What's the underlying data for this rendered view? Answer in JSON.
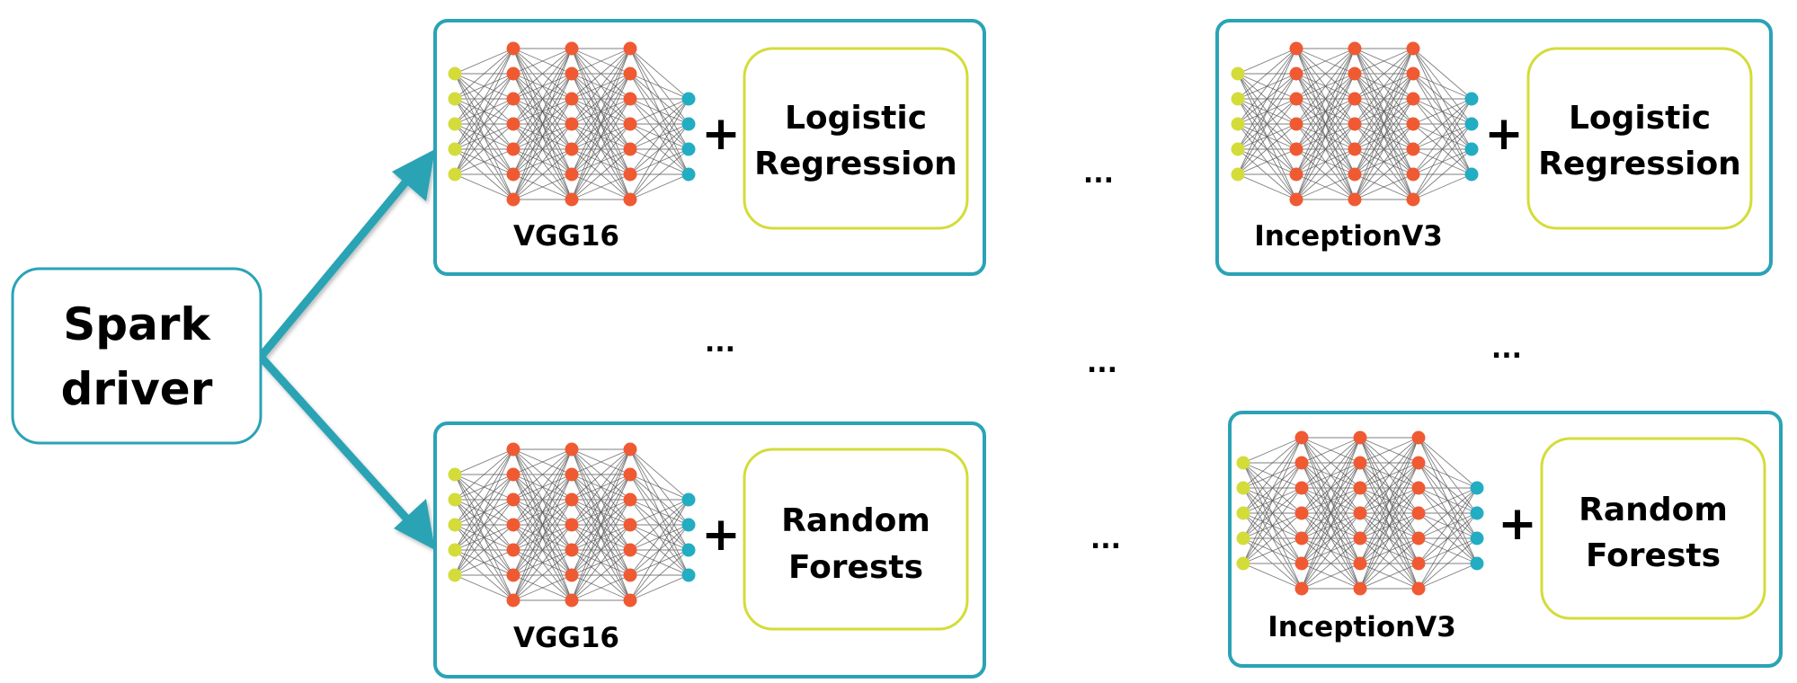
{
  "driver": {
    "line1": "Spark",
    "line2": "driver"
  },
  "colors": {
    "accent": "#2aa3b5",
    "classifier_border": "#d4dc3a",
    "input_node": "#d4dc3a",
    "hidden_node": "#f05a33",
    "output_node": "#22adc3"
  },
  "workers": [
    {
      "model": "VGG16",
      "plus": "+",
      "classifier": [
        "Logistic",
        "Regression"
      ]
    },
    {
      "model": "InceptionV3",
      "plus": "+",
      "classifier": [
        "Logistic",
        "Regression"
      ]
    },
    {
      "model": "VGG16",
      "plus": "+",
      "classifier": [
        "Random",
        "Forests"
      ]
    },
    {
      "model": "InceptionV3",
      "plus": "+",
      "classifier": [
        "Random",
        "Forests"
      ]
    }
  ],
  "network": {
    "input_nodes": 5,
    "hidden_layers": 3,
    "hidden_nodes": 7,
    "output_nodes": 4
  },
  "ellipsis": "..."
}
